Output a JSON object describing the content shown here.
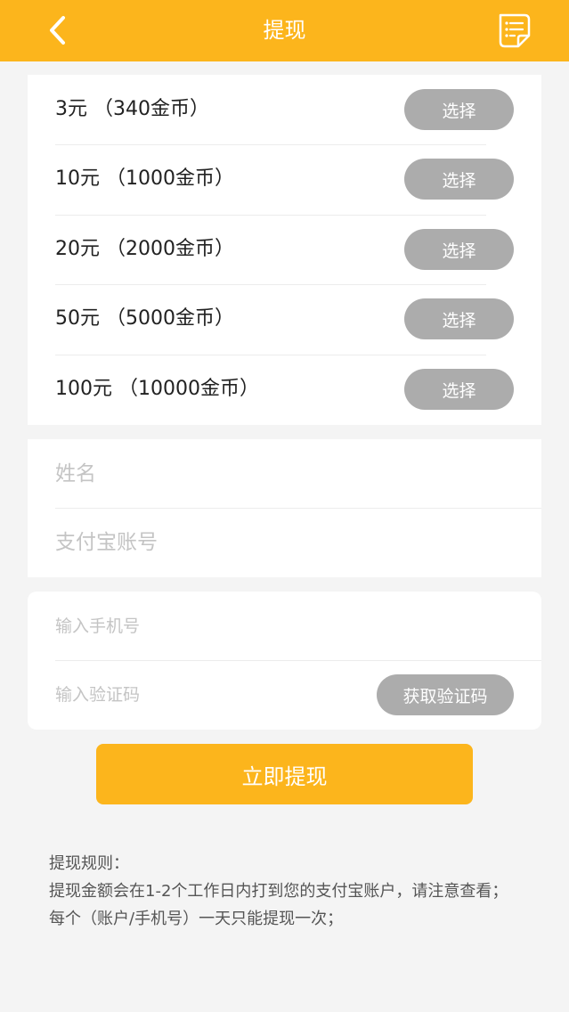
{
  "nav": {
    "title": "提现",
    "back_icon": "chevron-left-icon",
    "record_icon": "document-list-icon"
  },
  "options": [
    {
      "label": "3元 （340金币）",
      "button": "选择"
    },
    {
      "label": "10元 （1000金币）",
      "button": "选择"
    },
    {
      "label": "20元 （2000金币）",
      "button": "选择"
    },
    {
      "label": "50元 （5000金币）",
      "button": "选择"
    },
    {
      "label": "100元 （10000金币）",
      "button": "选择"
    }
  ],
  "account": {
    "name_placeholder": "姓名",
    "alipay_placeholder": "支付宝账号"
  },
  "verify": {
    "phone_placeholder": "输入手机号",
    "code_placeholder": "输入验证码",
    "get_code_label": "获取验证码"
  },
  "submit_label": "立即提现",
  "rules": {
    "title": "提现规则：",
    "line1": "提现金额会在1-2个工作日内打到您的支付宝账户，请注意查看；",
    "line2": "每个（账户/手机号）一天只能提现一次；"
  },
  "colors": {
    "accent": "#fcb51c",
    "button_gray": "#acacac",
    "background": "#f4f4f4"
  }
}
